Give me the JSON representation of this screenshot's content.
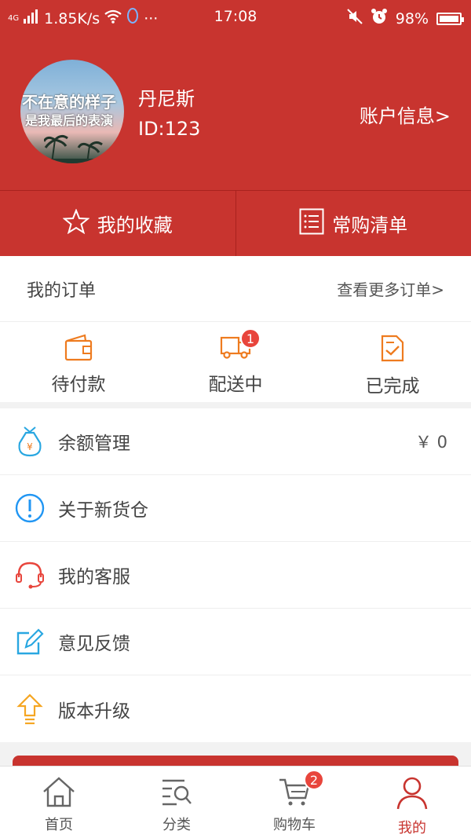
{
  "status_bar": {
    "network": "4G",
    "speed": "1.85K/s",
    "more": "···",
    "time": "17:08",
    "battery": "98%"
  },
  "profile": {
    "avatar_text_line1": "不在意的样子",
    "avatar_text_line2": "是我最后的表演",
    "username": "丹尼斯",
    "user_id": "ID:123",
    "account_link": "账户信息>"
  },
  "quick_tabs": [
    {
      "label": "我的收藏",
      "icon": "star-icon"
    },
    {
      "label": "常购清单",
      "icon": "list-icon"
    }
  ],
  "orders": {
    "title": "我的订单",
    "more": "查看更多订单>",
    "statuses": [
      {
        "label": "待付款",
        "icon": "wallet-icon",
        "badge": ""
      },
      {
        "label": "配送中",
        "icon": "truck-icon",
        "badge": "1"
      },
      {
        "label": "已完成",
        "icon": "clipboard-check-icon",
        "badge": ""
      }
    ]
  },
  "menu": [
    {
      "label": "余额管理",
      "icon": "money-bag-icon",
      "value": "￥ 0"
    },
    {
      "label": "关于新货仓",
      "icon": "info-icon",
      "value": ""
    },
    {
      "label": "我的客服",
      "icon": "headset-icon",
      "value": ""
    },
    {
      "label": "意见反馈",
      "icon": "edit-icon",
      "value": ""
    },
    {
      "label": "版本升级",
      "icon": "upgrade-icon",
      "value": ""
    }
  ],
  "bottom_nav": [
    {
      "label": "首页",
      "icon": "home-icon",
      "active": false
    },
    {
      "label": "分类",
      "icon": "category-search-icon",
      "active": false
    },
    {
      "label": "购物车",
      "icon": "cart-icon",
      "active": false,
      "badge": "2"
    },
    {
      "label": "我的",
      "icon": "user-icon",
      "active": true
    }
  ],
  "colors": {
    "brand_red": "#c8342f",
    "icon_orange": "#ee7b1f",
    "info_blue": "#2196f3",
    "badge_red": "#e8453c"
  }
}
